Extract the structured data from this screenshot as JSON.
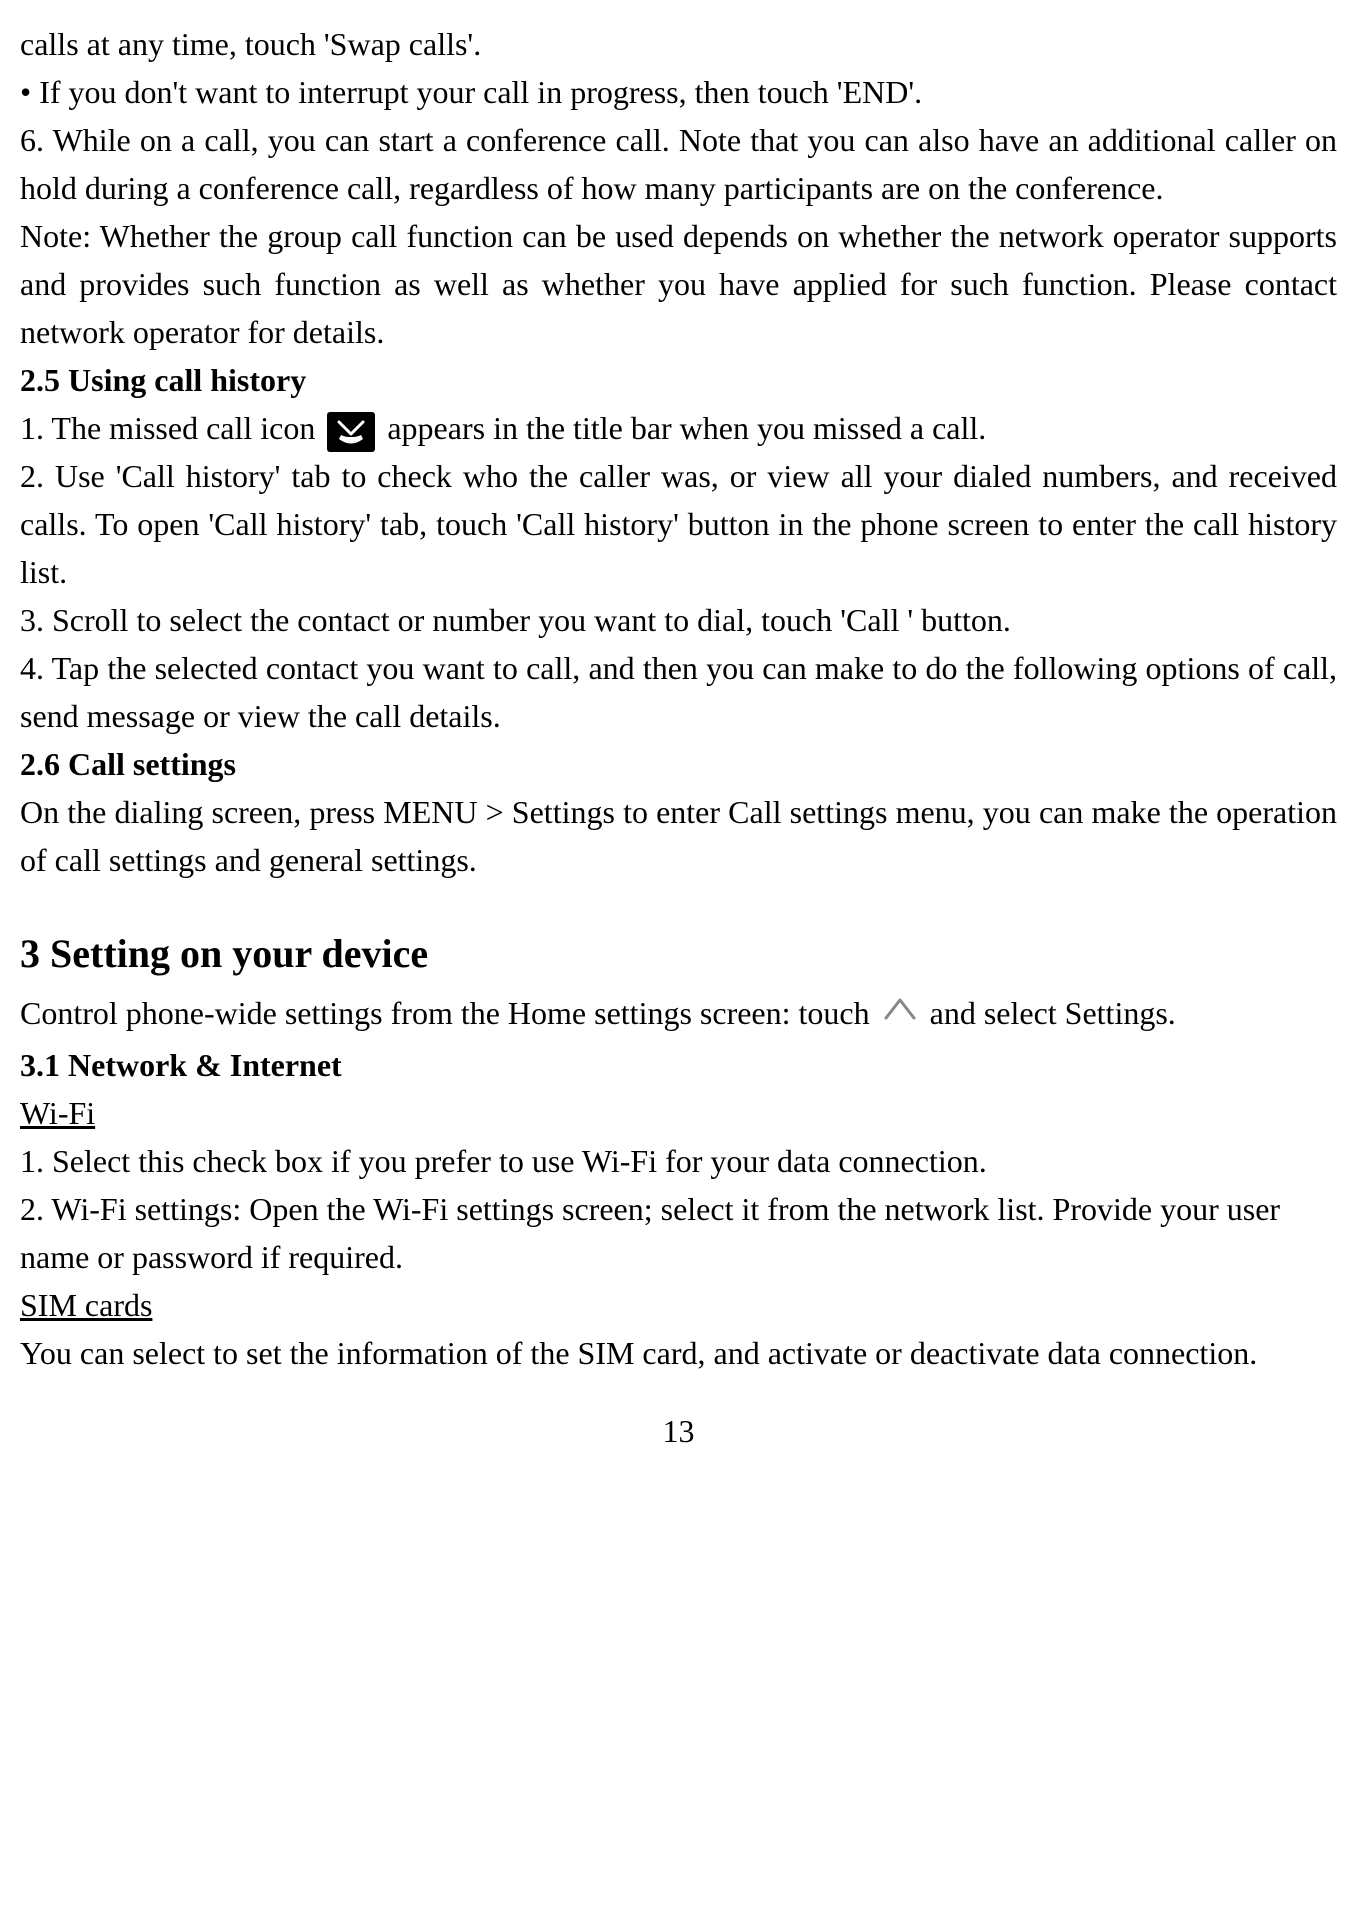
{
  "p1": "calls at any time, touch 'Swap calls'.",
  "p2": "• If you don't want to interrupt your call in progress, then touch 'END'.",
  "p3": "6. While on a call, you can start a conference call. Note that you can also have an additional caller on hold during a conference call, regardless of how many participants are on the conference.",
  "p4": "Note: Whether the group call function can be used depends on whether the network operator supports and provides such function as well as whether you have applied for such function. Please contact network operator for details.",
  "h25": "2.5 Using call history",
  "p5a": "1. The missed call icon ",
  "p5b": " appears in the title bar when you missed a call.",
  "p6": "2. Use 'Call history' tab to check who the caller was, or view all your dialed numbers, and received calls. To open 'Call history' tab, touch 'Call history' button in the phone screen to enter the call history list.",
  "p7": "3. Scroll to select the contact or number you want to dial, touch 'Call ' button.",
  "p8": "4. Tap the selected contact you want to call, and then you can make to do the following options of call, send message or view the call details.",
  "h26": "2.6 Call settings",
  "p9": "On the dialing screen, press MENU > Settings to enter Call settings menu, you can make the operation of call settings and general settings.",
  "h3": "3 Setting on your device",
  "p10a": "Control phone-wide settings from the Home settings screen: touch ",
  "p10b": " and select Settings.",
  "h31": "3.1 Network & Internet",
  "wifi": "Wi-Fi",
  "p11": "1. Select this check box if you prefer to use Wi-Fi for your data connection.",
  "p12": "2. Wi-Fi settings: Open the Wi-Fi settings screen; select it from the network list. Provide your user name or password if required.",
  "sim": "SIM cards",
  "p13": "You can select to set the information of the SIM card, and activate or deactivate data connection.",
  "pageNum": "13"
}
